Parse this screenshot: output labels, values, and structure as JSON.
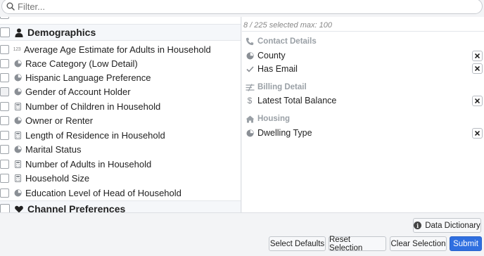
{
  "filter": {
    "placeholder": "Filter..."
  },
  "left": {
    "groups": {
      "demographics": "Demographics",
      "channel": "Channel Preferences"
    },
    "items": [
      {
        "label": "Average Age Estimate for Adults in Household",
        "icon": "numeric-icon",
        "icon_text": "123"
      },
      {
        "label": "Race Category (Low Detail)",
        "icon": "pie-chart-icon"
      },
      {
        "label": "Hispanic Language Preference",
        "icon": "pie-chart-icon"
      },
      {
        "label": "Gender of Account Holder",
        "icon": "pie-chart-icon"
      },
      {
        "label": "Number of Children in Household",
        "icon": "calculator-icon"
      },
      {
        "label": "Owner or Renter",
        "icon": "pie-chart-icon"
      },
      {
        "label": "Length of Residence in Household",
        "icon": "calculator-icon"
      },
      {
        "label": "Marital Status",
        "icon": "pie-chart-icon"
      },
      {
        "label": "Number of Adults in Household",
        "icon": "calculator-icon"
      },
      {
        "label": "Household Size",
        "icon": "calculator-icon"
      },
      {
        "label": "Education Level of Head of Household",
        "icon": "pie-chart-icon"
      }
    ]
  },
  "right": {
    "selected_count": "8 / 225 selected max: 100",
    "sections": [
      {
        "title": "Contact Details",
        "icon": "phone-icon",
        "items": [
          {
            "label": "County",
            "icon": "pie-chart-icon"
          },
          {
            "label": "Has Email",
            "icon": "check-icon"
          }
        ]
      },
      {
        "title": "Billing Detail",
        "icon": "money-icon",
        "items": [
          {
            "label": "Latest Total Balance",
            "icon": "dollar-icon"
          }
        ]
      },
      {
        "title": "Housing",
        "icon": "home-icon",
        "items": [
          {
            "label": "Dwelling Type",
            "icon": "pie-chart-icon"
          }
        ]
      }
    ]
  },
  "footer": {
    "data_dictionary": "Data Dictionary",
    "select_defaults": "Select Defaults",
    "reset_selection": "Reset Selection",
    "clear_selection": "Clear Selection",
    "submit": "Submit"
  },
  "colors": {
    "accent": "#2f6fe0",
    "muted": "#9aa0a6"
  }
}
